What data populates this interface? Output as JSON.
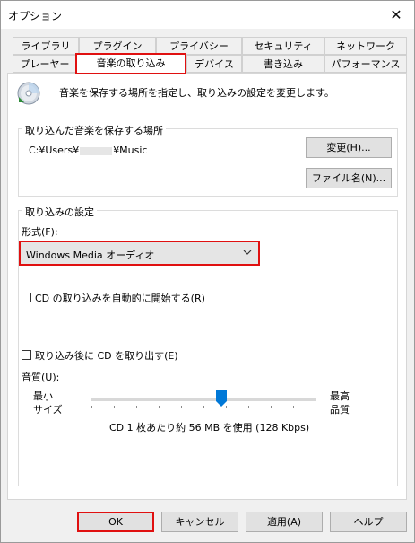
{
  "window": {
    "title": "オプション",
    "close_label": "✕"
  },
  "tabs_row1": [
    "ライブラリ",
    "プラグイン",
    "プライバシー",
    "セキュリティ",
    "ネットワーク"
  ],
  "tabs_row2": [
    "プレーヤー",
    "音楽の取り込み",
    "デバイス",
    "書き込み",
    "パフォーマンス"
  ],
  "active_tab": "音楽の取り込み",
  "description": "音楽を保存する場所を指定し、取り込みの設定を変更します。",
  "location": {
    "group_label": "取り込んだ音楽を保存する場所",
    "path_prefix": "C:¥Users¥",
    "path_suffix": "¥Music",
    "change_button": "変更(H)...",
    "filename_button": "ファイル名(N)..."
  },
  "settings": {
    "group_label": "取り込みの設定",
    "format_label": "形式(F):",
    "format_value": "Windows Media オーディオ",
    "auto_rip_label": "CD の取り込みを自動的に開始する(R)",
    "eject_label": "取り込み後に CD を取り出す(E)",
    "quality_label": "音質(U):",
    "min_label_1": "最小",
    "min_label_2": "サイズ",
    "max_label_1": "最高",
    "max_label_2": "品質",
    "usage_text": "CD 1 枚あたり約 56 MB を使用 (128 Kbps)",
    "slider_position_fraction": 0.58
  },
  "buttons": {
    "ok": "OK",
    "cancel": "キャンセル",
    "apply": "適用(A)",
    "help": "ヘルプ"
  },
  "colors": {
    "highlight": "#e01010",
    "thumb": "#0078d7"
  }
}
